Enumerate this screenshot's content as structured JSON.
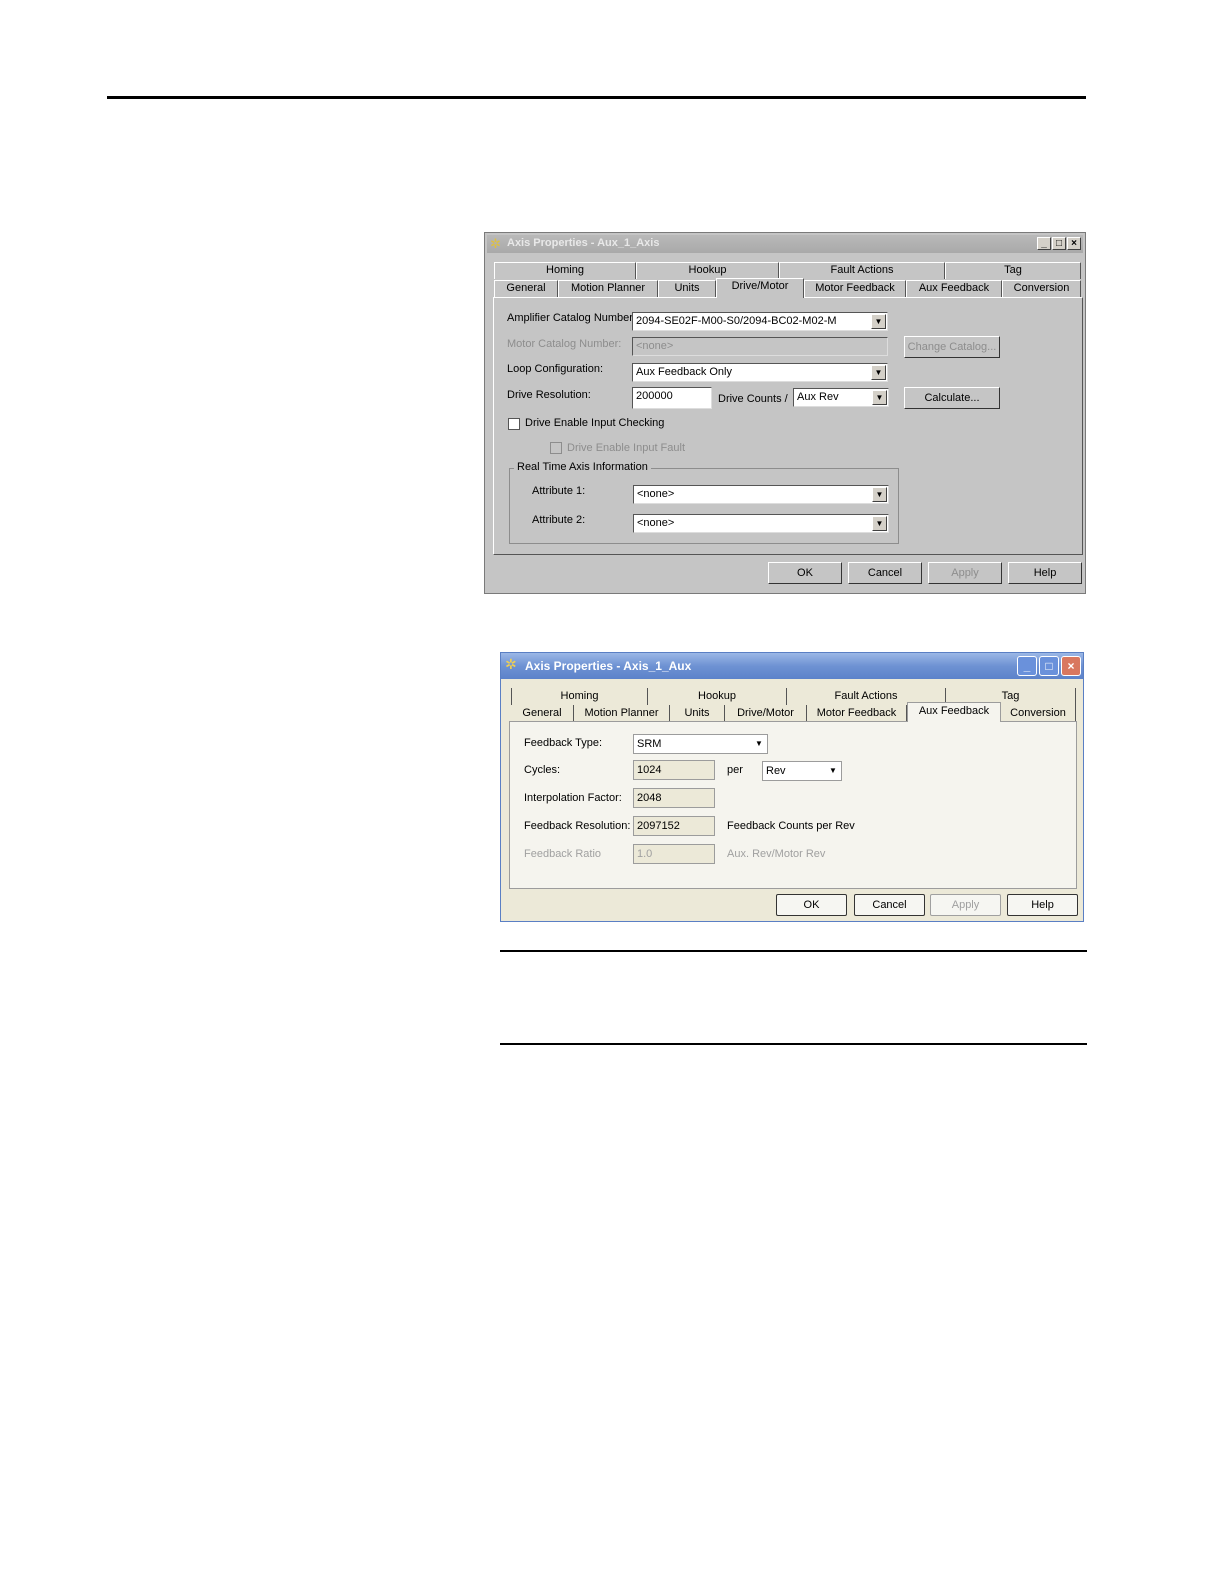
{
  "dialog1": {
    "title": "Axis Properties - Aux_1_Axis",
    "tabs_row1": [
      "Homing",
      "Hookup",
      "Fault Actions",
      "Tag"
    ],
    "tabs_row2": [
      "General",
      "Motion Planner",
      "Units",
      "Drive/Motor",
      "Motor Feedback",
      "Aux Feedback",
      "Conversion"
    ],
    "selected_tab": "Drive/Motor",
    "amplifier_label": "Amplifier Catalog Number:",
    "amplifier_value": "2094-SE02F-M00-S0/2094-BC02-M02-M",
    "motor_label": "Motor Catalog Number:",
    "motor_value": "<none>",
    "change_catalog": "Change Catalog...",
    "loop_label": "Loop Configuration:",
    "loop_value": "Aux Feedback Only",
    "drive_res_label": "Drive Resolution:",
    "drive_res_value": "200000",
    "drive_counts_label": "Drive Counts /",
    "drive_counts_value": "Aux Rev",
    "calculate": "Calculate...",
    "enable_check_label": "Drive Enable Input Checking",
    "enable_fault_label": "Drive Enable Input Fault",
    "rt_group": "Real Time Axis Information",
    "attr1_label": "Attribute 1:",
    "attr1_value": "<none>",
    "attr2_label": "Attribute 2:",
    "attr2_value": "<none>",
    "ok": "OK",
    "cancel": "Cancel",
    "apply": "Apply",
    "help": "Help"
  },
  "dialog2": {
    "title": "Axis Properties - Axis_1_Aux",
    "tabs_row1": [
      "Homing",
      "Hookup",
      "Fault Actions",
      "Tag"
    ],
    "tabs_row2": [
      "General",
      "Motion Planner",
      "Units",
      "Drive/Motor",
      "Motor Feedback",
      "Aux Feedback",
      "Conversion"
    ],
    "selected_tab": "Aux Feedback",
    "feedback_type_label": "Feedback Type:",
    "feedback_type_value": "SRM",
    "cycles_label": "Cycles:",
    "cycles_value": "1024",
    "per_label": "per",
    "per_value": "Rev",
    "interp_label": "Interpolation Factor:",
    "interp_value": "2048",
    "fb_res_label": "Feedback Resolution:",
    "fb_res_value": "2097152",
    "fb_res_unit": "Feedback Counts per Rev",
    "fb_ratio_label": "Feedback Ratio",
    "fb_ratio_value": "1.0",
    "fb_ratio_unit": "Aux. Rev/Motor Rev",
    "ok": "OK",
    "cancel": "Cancel",
    "apply": "Apply",
    "help": "Help"
  }
}
